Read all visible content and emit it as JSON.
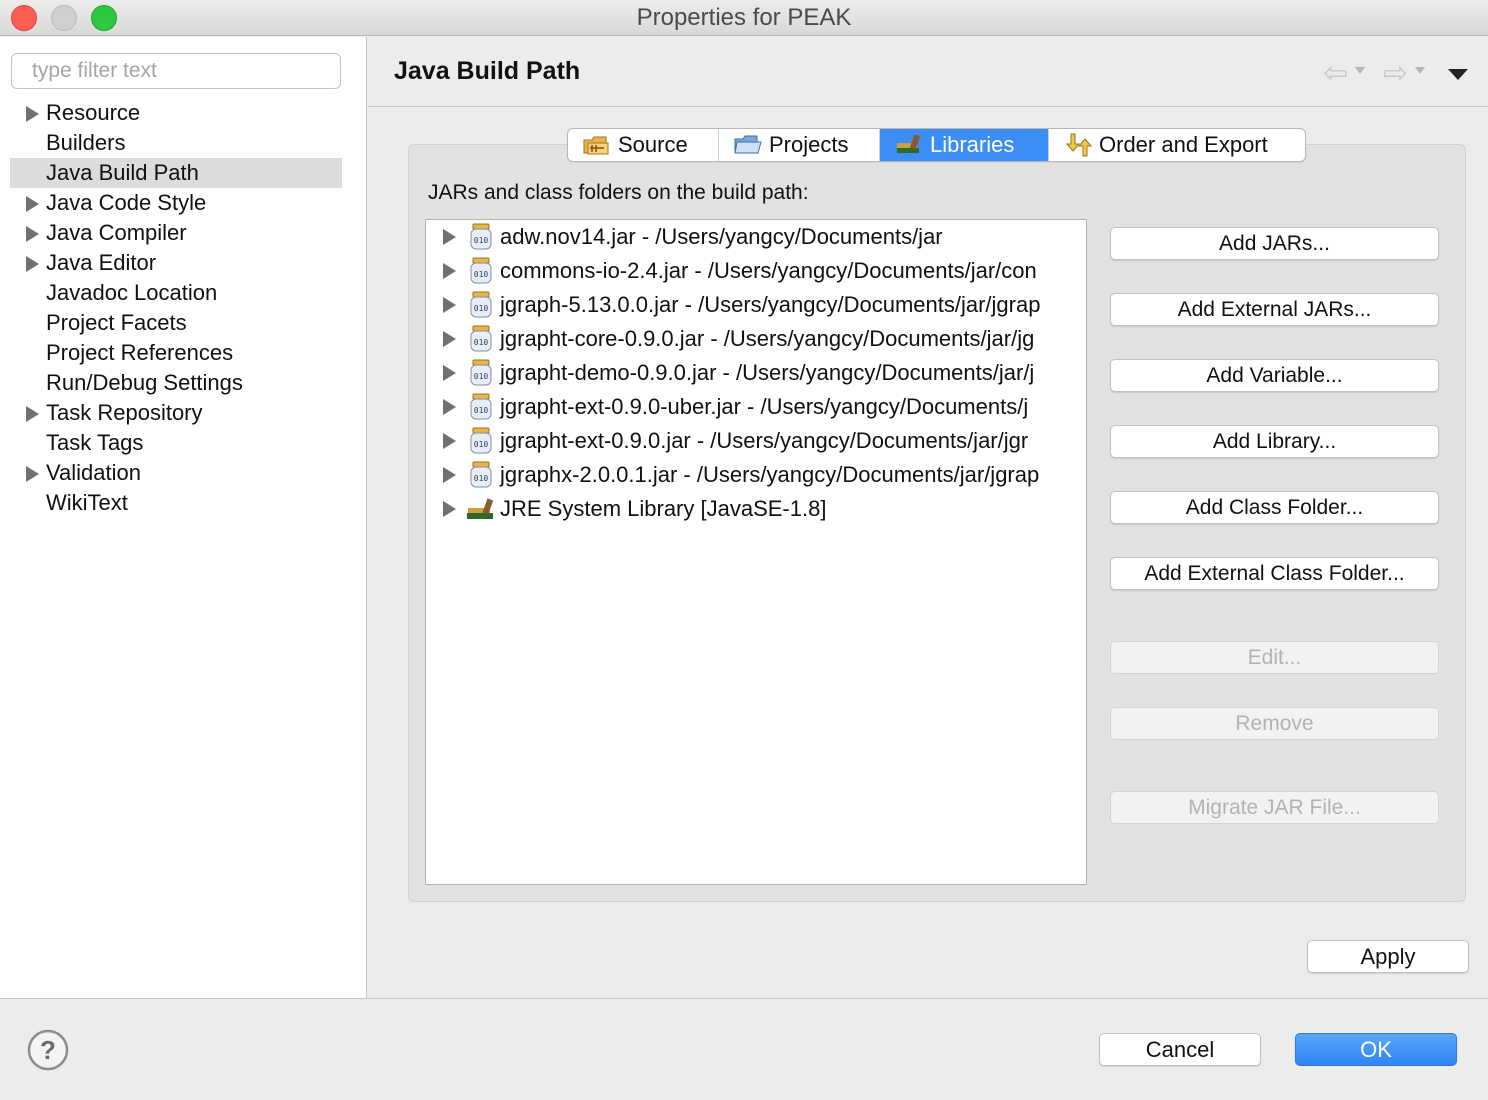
{
  "window": {
    "title": "Properties for PEAK"
  },
  "sidebar": {
    "filter_placeholder": "type filter text",
    "items": [
      {
        "label": "Resource",
        "expandable": true,
        "selected": false
      },
      {
        "label": "Builders",
        "expandable": false,
        "selected": false
      },
      {
        "label": "Java Build Path",
        "expandable": false,
        "selected": true
      },
      {
        "label": "Java Code Style",
        "expandable": true,
        "selected": false
      },
      {
        "label": "Java Compiler",
        "expandable": true,
        "selected": false
      },
      {
        "label": "Java Editor",
        "expandable": true,
        "selected": false
      },
      {
        "label": "Javadoc Location",
        "expandable": false,
        "selected": false
      },
      {
        "label": "Project Facets",
        "expandable": false,
        "selected": false
      },
      {
        "label": "Project References",
        "expandable": false,
        "selected": false
      },
      {
        "label": "Run/Debug Settings",
        "expandable": false,
        "selected": false
      },
      {
        "label": "Task Repository",
        "expandable": true,
        "selected": false
      },
      {
        "label": "Task Tags",
        "expandable": false,
        "selected": false
      },
      {
        "label": "Validation",
        "expandable": true,
        "selected": false
      },
      {
        "label": "WikiText",
        "expandable": false,
        "selected": false
      }
    ]
  },
  "header": {
    "title": "Java Build Path"
  },
  "tabs": [
    {
      "label": "Source",
      "icon": "source-folder-icon",
      "active": false
    },
    {
      "label": "Projects",
      "icon": "projects-folder-icon",
      "active": false
    },
    {
      "label": "Libraries",
      "icon": "libraries-icon",
      "active": true
    },
    {
      "label": "Order and Export",
      "icon": "order-export-icon",
      "active": false
    }
  ],
  "libraries": {
    "label": "JARs and class folders on the build path:",
    "items": [
      {
        "text": "adw.nov14.jar - /Users/yangcy/Documents/jar",
        "icon": "jar-icon"
      },
      {
        "text": "commons-io-2.4.jar - /Users/yangcy/Documents/jar/con",
        "icon": "jar-icon"
      },
      {
        "text": "jgraph-5.13.0.0.jar - /Users/yangcy/Documents/jar/jgrap",
        "icon": "jar-icon"
      },
      {
        "text": "jgrapht-core-0.9.0.jar - /Users/yangcy/Documents/jar/jg",
        "icon": "jar-icon"
      },
      {
        "text": "jgrapht-demo-0.9.0.jar - /Users/yangcy/Documents/jar/j",
        "icon": "jar-icon"
      },
      {
        "text": "jgrapht-ext-0.9.0-uber.jar - /Users/yangcy/Documents/j",
        "icon": "jar-icon"
      },
      {
        "text": "jgrapht-ext-0.9.0.jar - /Users/yangcy/Documents/jar/jgr",
        "icon": "jar-icon"
      },
      {
        "text": "jgraphx-2.0.0.1.jar - /Users/yangcy/Documents/jar/jgrap",
        "icon": "jar-icon"
      },
      {
        "text": "JRE System Library [JavaSE-1.8]",
        "icon": "jre-library-icon"
      }
    ]
  },
  "buttons": {
    "add_jars": "Add JARs...",
    "add_external_jars": "Add External JARs...",
    "add_variable": "Add Variable...",
    "add_library": "Add Library...",
    "add_class_folder": "Add Class Folder...",
    "add_external_class_folder": "Add External Class Folder...",
    "edit": "Edit...",
    "remove": "Remove",
    "migrate_jar": "Migrate JAR File...",
    "apply": "Apply",
    "cancel": "Cancel",
    "ok": "OK"
  },
  "colors": {
    "accent": "#3c8ef6",
    "ok_button": "#2f83f5",
    "close": "#fd5f57",
    "maximize": "#2fc840"
  }
}
